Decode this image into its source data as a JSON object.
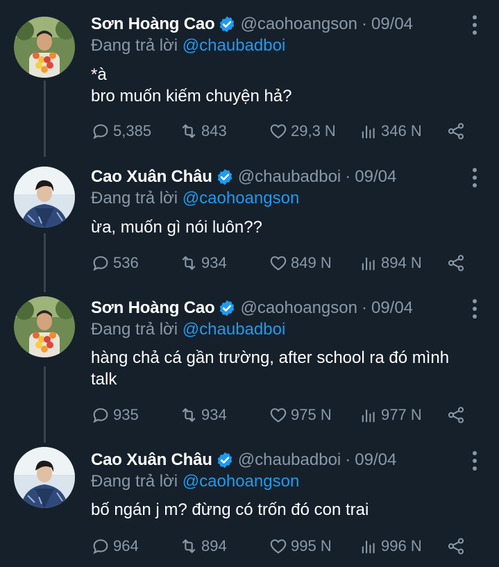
{
  "colors": {
    "background": "#15202b",
    "text": "#ffffff",
    "muted": "#8b98a5",
    "accent": "#1d9bf0",
    "thread_line": "#38444d"
  },
  "tweets": [
    {
      "name": "Sơn Hoàng Cao",
      "handle": "@caohoangson",
      "dot": "·",
      "date": "09/04",
      "replying_prefix": "Đang trả lời",
      "replying_to": "@chaubadboi",
      "lines": [
        "*à",
        "bro muốn kiếm chuyện hả?"
      ],
      "replies": "5,385",
      "retweets": "843",
      "likes": "29,3 N",
      "views": "346 N",
      "avatar": "son-avatar"
    },
    {
      "name": "Cao Xuân Châu",
      "handle": "@chaubadboi",
      "dot": "·",
      "date": "09/04",
      "replying_prefix": "Đang trả lời",
      "replying_to": "@caohoangson",
      "lines": [
        "ừa, muốn gì nói luôn??"
      ],
      "replies": "536",
      "retweets": "934",
      "likes": "849 N",
      "views": "894 N",
      "avatar": "chau-avatar"
    },
    {
      "name": "Sơn Hoàng Cao",
      "handle": "@caohoangson",
      "dot": "·",
      "date": "09/04",
      "replying_prefix": "Đang trả lời",
      "replying_to": "@chaubadboi",
      "lines": [
        "hàng chả cá gần trường, after school ra đó mình",
        "talk"
      ],
      "replies": "935",
      "retweets": "934",
      "likes": "975 N",
      "views": "977 N",
      "avatar": "son-avatar"
    },
    {
      "name": "Cao Xuân Châu",
      "handle": "@chaubadboi",
      "dot": "·",
      "date": "09/04",
      "replying_prefix": "Đang trả lời",
      "replying_to": "@caohoangson",
      "lines": [
        "bố ngán j m? đừng có trốn đó con trai"
      ],
      "replies": "964",
      "retweets": "894",
      "likes": "995 N",
      "views": "996 N",
      "avatar": "chau-avatar"
    }
  ]
}
